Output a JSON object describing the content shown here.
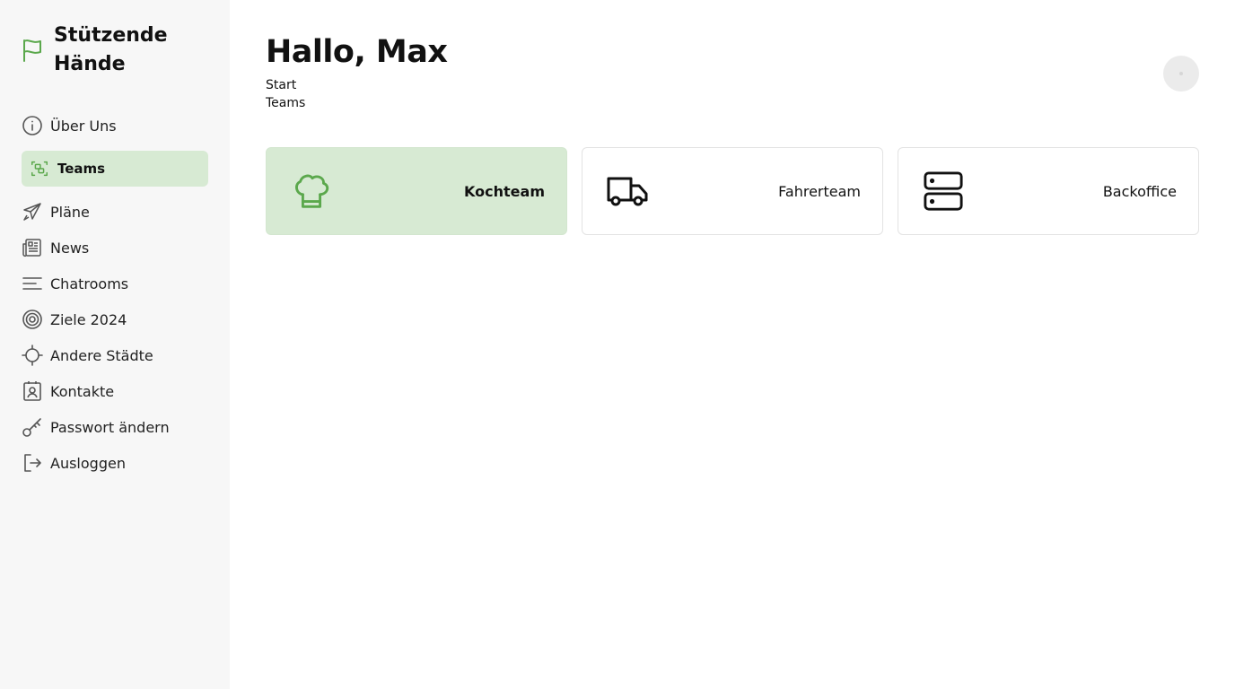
{
  "app": {
    "title": "Stützende Hände",
    "accent_color": "#5ba84c",
    "active_bg": "#d7ead3"
  },
  "sidebar": {
    "items": [
      {
        "label": "Über Uns",
        "icon": "info-icon"
      },
      {
        "label": "Teams",
        "icon": "team-frame-icon",
        "active": true
      },
      {
        "label": "Pläne",
        "icon": "airplane-icon"
      },
      {
        "label": "News",
        "icon": "newspaper-icon"
      },
      {
        "label": "Chatrooms",
        "icon": "lines-icon"
      },
      {
        "label": "Ziele 2024",
        "icon": "target-icon"
      },
      {
        "label": "Andere Städte",
        "icon": "crosshair-icon"
      },
      {
        "label": "Kontakte",
        "icon": "contact-card-icon"
      },
      {
        "label": "Passwort ändern",
        "icon": "key-icon"
      },
      {
        "label": "Ausloggen",
        "icon": "logout-icon"
      }
    ]
  },
  "header": {
    "greeting": "Hallo, Max",
    "breadcrumbs": [
      "Start",
      "Teams"
    ]
  },
  "teams": [
    {
      "label": "Kochteam",
      "icon": "chef-hat-icon",
      "active": true
    },
    {
      "label": "Fahrerteam",
      "icon": "truck-icon"
    },
    {
      "label": "Backoffice",
      "icon": "server-icon"
    }
  ]
}
